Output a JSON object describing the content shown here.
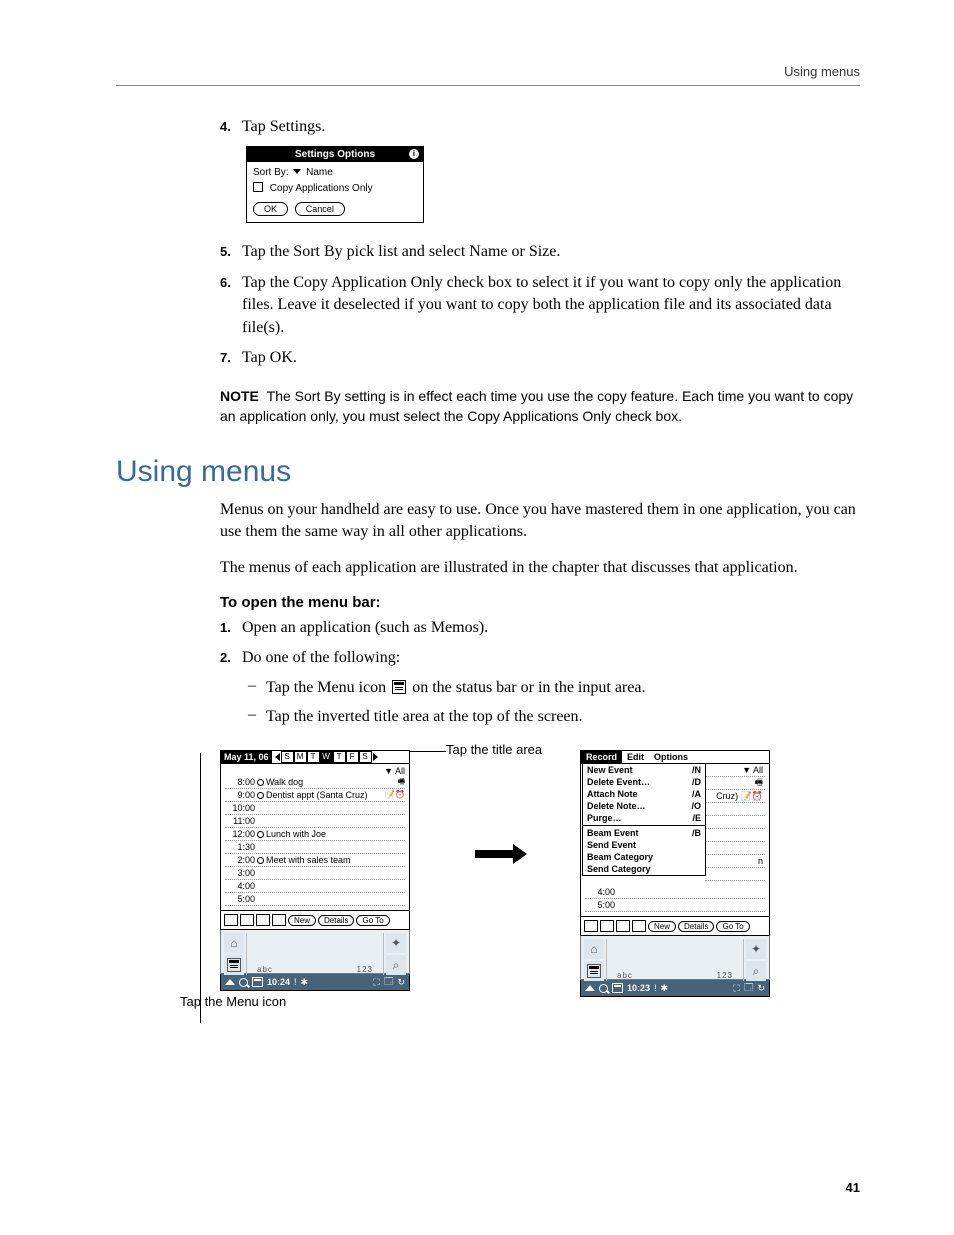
{
  "running_header": "Using menus",
  "page_number": "41",
  "steps_top": {
    "s4_num": "4.",
    "s4_text": "Tap Settings.",
    "s5_num": "5.",
    "s5_text": "Tap the Sort By pick list and select Name or Size.",
    "s6_num": "6.",
    "s6_text": "Tap the Copy Application Only check box to select it if you want to copy only the application files. Leave it deselected if you want to copy both the application file and its associated data file(s).",
    "s7_num": "7.",
    "s7_text": "Tap OK."
  },
  "settings_dialog": {
    "title": "Settings Options",
    "info": "i",
    "sortby_label": "Sort By:",
    "sortby_value": "Name",
    "copy_label": "Copy Applications Only",
    "ok": "OK",
    "cancel": "Cancel"
  },
  "note": {
    "label": "NOTE",
    "text": "The Sort By setting is in effect each time you use the copy feature. Each time you want to copy an application only, you must select the Copy Applications Only check box."
  },
  "section_heading": "Using menus",
  "paras": {
    "p1": "Menus on your handheld are easy to use. Once you have mastered them in one application, you can use them the same way in all other applications.",
    "p2": "The menus of each application are illustrated in the chapter that discusses that application."
  },
  "subhead": "To open the menu bar:",
  "steps_bottom": {
    "s1_num": "1.",
    "s1_text": "Open an application (such as Memos).",
    "s2_num": "2.",
    "s2_text": "Do one of the following:",
    "d1_prefix": "Tap the Menu icon ",
    "d1_suffix": " on the status bar or in the input area.",
    "d2": "Tap the inverted title area at the top of the screen."
  },
  "callouts": {
    "top": "Tap the title area",
    "bottom": "Tap the Menu icon"
  },
  "device_left": {
    "date": "May 11, 06",
    "days": [
      "S",
      "M",
      "T",
      "W",
      "T",
      "F",
      "S"
    ],
    "selected_day_index": 3,
    "category": "▼ All",
    "schedule": [
      {
        "time": "8:00",
        "bullet": true,
        "text": "Walk dog",
        "icons": "🖷"
      },
      {
        "time": "9:00",
        "bullet": true,
        "text": "Dentist appt (Santa Cruz)",
        "icons": "📝⏰"
      },
      {
        "time": "10:00",
        "bullet": false,
        "text": "",
        "icons": ""
      },
      {
        "time": "11:00",
        "bullet": false,
        "text": "",
        "icons": ""
      },
      {
        "time": "12:00",
        "bullet": true,
        "text": "Lunch with Joe",
        "icons": ""
      },
      {
        "time": "1:30",
        "bullet": false,
        "text": "",
        "icons": ""
      },
      {
        "time": "2:00",
        "bullet": true,
        "text": "Meet with sales team",
        "icons": ""
      },
      {
        "time": "3:00",
        "bullet": false,
        "text": "",
        "icons": ""
      },
      {
        "time": "4:00",
        "bullet": false,
        "text": "",
        "icons": ""
      },
      {
        "time": "5:00",
        "bullet": false,
        "text": "",
        "icons": ""
      }
    ],
    "btn_new": "New",
    "btn_details": "Details",
    "btn_goto": "Go To",
    "graffiti_abc": "abc",
    "graffiti_123": "123",
    "status_time": "10:24"
  },
  "device_right": {
    "menus": {
      "record": "Record",
      "edit": "Edit",
      "options": "Options"
    },
    "items": [
      {
        "label": "New Event",
        "shortcut": "/N"
      },
      {
        "label": "Delete Event…",
        "shortcut": "/D"
      },
      {
        "label": "Attach Note",
        "shortcut": "/A"
      },
      {
        "label": "Delete Note…",
        "shortcut": "/O"
      },
      {
        "label": "Purge…",
        "shortcut": "/E"
      }
    ],
    "items2": [
      {
        "label": "Beam Event",
        "shortcut": "/B"
      },
      {
        "label": "Send Event",
        "shortcut": ""
      },
      {
        "label": "Beam Category",
        "shortcut": ""
      },
      {
        "label": "Send Category",
        "shortcut": ""
      }
    ],
    "peek_all": "▼ All",
    "peek_cruz": "Cruz)  📝⏰",
    "peek_n": "n",
    "remainder": [
      {
        "time": "4:00",
        "text": ""
      },
      {
        "time": "5:00",
        "text": ""
      }
    ],
    "btn_new": "New",
    "btn_details": "Details",
    "btn_goto": "Go To",
    "graffiti_abc": "abc",
    "graffiti_123": "123",
    "status_time": "10:23"
  },
  "status_icons": {
    "alert": "!",
    "bt": "✱",
    "full": "⛶",
    "screen": "🗔",
    "rot": "↻"
  }
}
